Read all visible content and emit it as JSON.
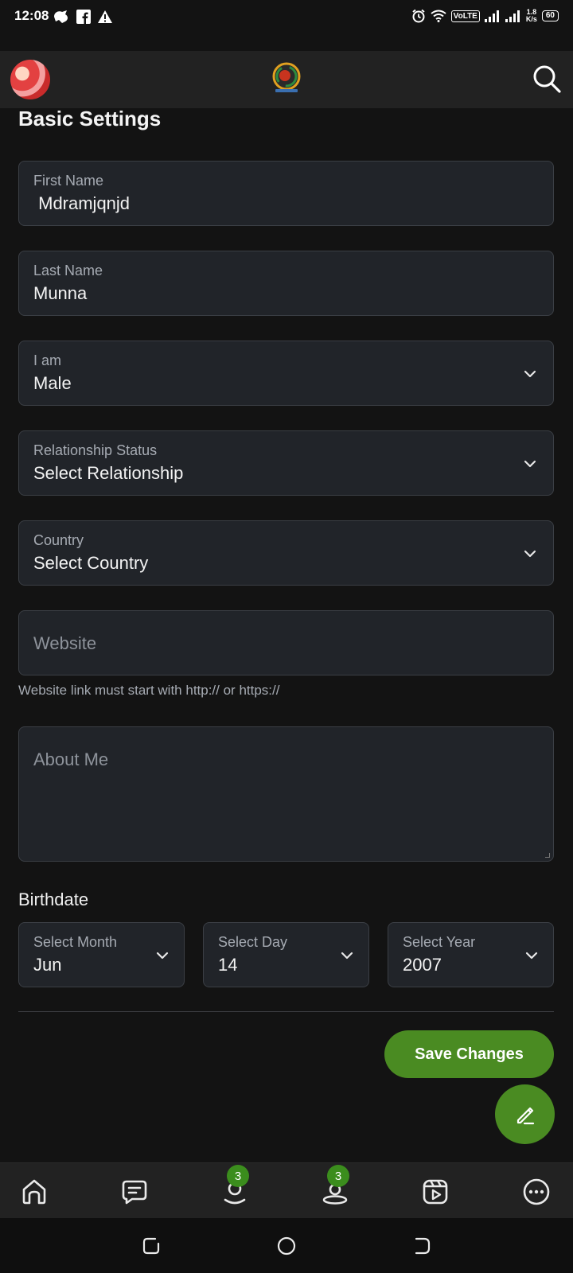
{
  "status_bar": {
    "time": "12:08",
    "network": "VoLTE",
    "speed_value": "1.8",
    "speed_unit": "K/s",
    "battery": "60"
  },
  "header": {
    "avatar_icon": "user-avatar",
    "logo_icon": "app-logo",
    "search_icon": "search-icon"
  },
  "page": {
    "section_title": "Basic Settings"
  },
  "form": {
    "first_name": {
      "label": "First Name",
      "value": " Mdramjqnjd"
    },
    "last_name": {
      "label": "Last Name",
      "value": "Munna"
    },
    "gender": {
      "label": "I am",
      "value": "Male"
    },
    "relationship": {
      "label": "Relationship Status",
      "value": "Select Relationship"
    },
    "country": {
      "label": "Country",
      "value": "Select Country"
    },
    "website": {
      "placeholder": "Website",
      "hint": "Website link must start with http:// or https://"
    },
    "about": {
      "placeholder": "About Me"
    },
    "birthdate": {
      "label": "Birthdate",
      "month": {
        "label": "Select Month",
        "value": "Jun"
      },
      "day": {
        "label": "Select Day",
        "value": "14"
      },
      "year": {
        "label": "Select Year",
        "value": "2007"
      }
    }
  },
  "actions": {
    "save_label": "Save Changes"
  },
  "bottom_nav": {
    "items": [
      {
        "name": "home",
        "icon": "home-icon"
      },
      {
        "name": "messages",
        "icon": "chat-icon"
      },
      {
        "name": "friend-requests",
        "icon": "user-request-icon",
        "badge": "3"
      },
      {
        "name": "notifications",
        "icon": "notification-icon",
        "badge": "3"
      },
      {
        "name": "reels",
        "icon": "video-icon"
      },
      {
        "name": "more",
        "icon": "more-icon"
      }
    ]
  },
  "colors": {
    "accent": "#4a8b22",
    "background": "#131313",
    "field_bg": "#212429",
    "field_border": "#3b3f45"
  }
}
